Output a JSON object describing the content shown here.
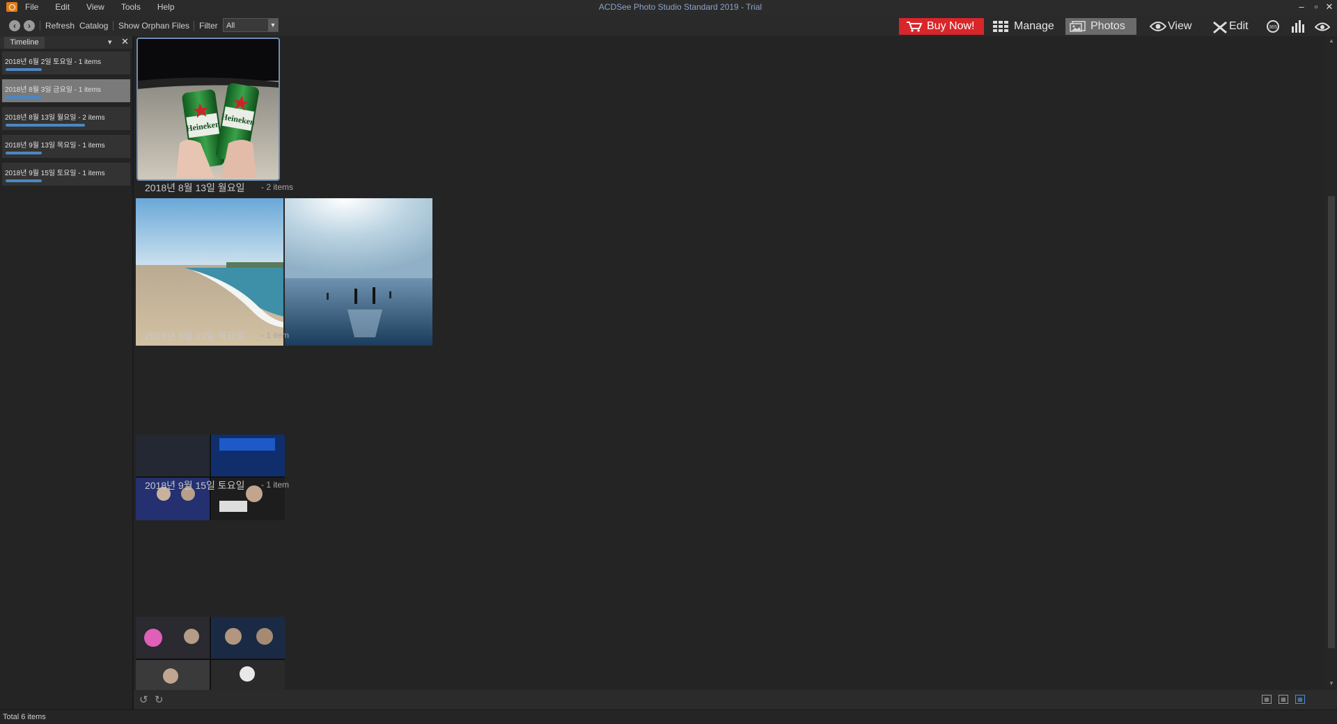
{
  "window": {
    "title": "ACDSee Photo Studio Standard 2019 - Trial",
    "min": "–",
    "max": "▫",
    "close": "✕"
  },
  "menu": [
    "File",
    "Edit",
    "View",
    "Tools",
    "Help"
  ],
  "toolbar": {
    "refresh": "Refresh",
    "catalog": "Catalog",
    "show_orphan": "Show Orphan Files",
    "filter_label": "Filter",
    "filter_value": "All",
    "buy_now": "Buy Now!",
    "modes": [
      "Manage",
      "Photos",
      "View",
      "Edit"
    ],
    "active_mode": "Photos"
  },
  "panel": {
    "title": "Timeline",
    "items": [
      {
        "label": "2018년 6월 2일 토요일 - 1 items",
        "count": 1
      },
      {
        "label": "2018년 8월 3일 금요일 - 1 items",
        "count": 1
      },
      {
        "label": "2018년 8월 13일 월요일 - 2 items",
        "count": 2
      },
      {
        "label": "2018년 9월 13일 목요일 - 1 items",
        "count": 1
      },
      {
        "label": "2018년 9월 15일 토요일 - 1 items",
        "count": 1
      }
    ],
    "selected_index": 1
  },
  "groups": [
    {
      "title": "2018년 8월 13일 월요일",
      "count": "- 2 items"
    },
    {
      "title": "2018년 9월 13일 목요일",
      "count": "- 1 item"
    },
    {
      "title": "2018년 9월 15일 토요일",
      "count": "- 1 item"
    }
  ],
  "status": {
    "text": "Total 6 items"
  },
  "colors": {
    "accent": "#4d87c2",
    "buy_now": "#d9262a",
    "background": "#242424"
  }
}
